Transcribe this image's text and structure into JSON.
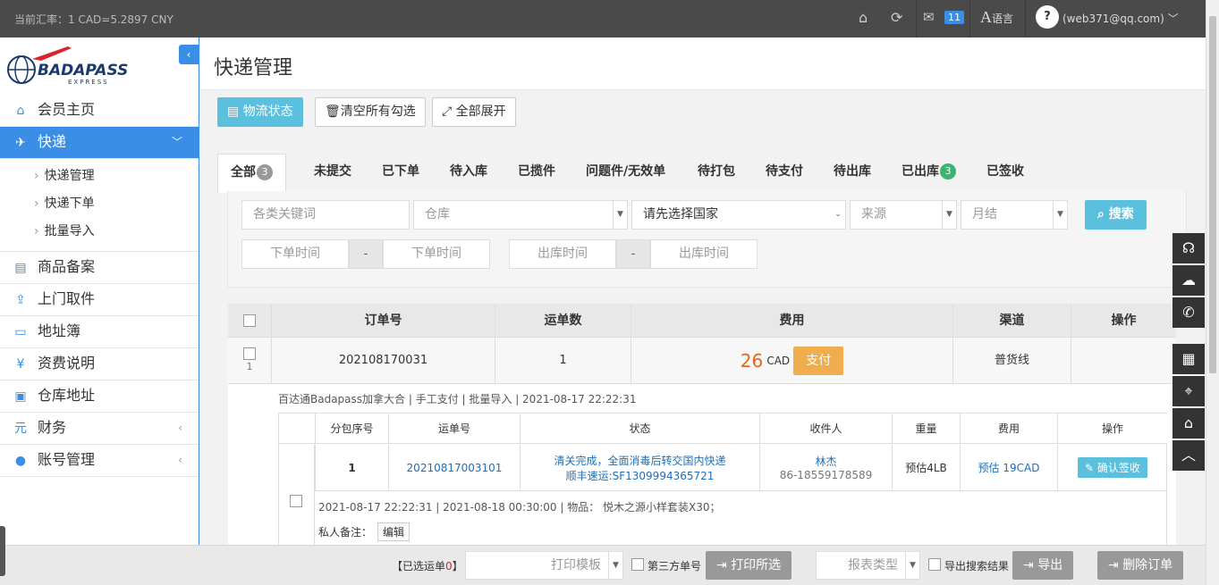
{
  "topbar": {
    "rate": "当前汇率：1 CAD=5.2897 CNY",
    "mail_count": "11",
    "lang_label": "语言",
    "user": "(web371@qq.com)"
  },
  "sidebar": {
    "brand": "BADAPASS",
    "brand_sub": "EXPRESS",
    "items": [
      {
        "label": "会员主页"
      },
      {
        "label": "快递"
      },
      {
        "label": "商品备案"
      },
      {
        "label": "上门取件"
      },
      {
        "label": "地址簿"
      },
      {
        "label": "资费说明"
      },
      {
        "label": "仓库地址"
      },
      {
        "label": "财务"
      },
      {
        "label": "账号管理"
      }
    ],
    "sub_items": [
      "快递管理",
      "快递下单",
      "批量导入"
    ]
  },
  "main": {
    "title": "快递管理",
    "toolbar": {
      "status_label": "物流状态",
      "clear_label": "清空所有勾选",
      "expand_label": "全部展开"
    },
    "tabs": [
      {
        "label": "全部",
        "badge": "3"
      },
      {
        "label": "未提交"
      },
      {
        "label": "已下单"
      },
      {
        "label": "待入库"
      },
      {
        "label": "已揽件"
      },
      {
        "label": "问题件/无效单"
      },
      {
        "label": "待打包"
      },
      {
        "label": "待支付"
      },
      {
        "label": "待出库"
      },
      {
        "label": "已出库",
        "badge": "3"
      },
      {
        "label": "已签收"
      }
    ],
    "filters": {
      "keyword_placeholder": "各类关键词",
      "warehouse_placeholder": "仓库",
      "country_placeholder": "请先选择国家",
      "source_placeholder": "来源",
      "monthly_placeholder": "月结",
      "search_label": "搜索",
      "order_time_start": "下单时间",
      "order_time_end": "下单时间",
      "out_time_start": "出库时间",
      "out_time_end": "出库时间",
      "dash": "-"
    },
    "table": {
      "headers": [
        "订单号",
        "运单数",
        "费用",
        "渠道",
        "操作"
      ],
      "row": {
        "index": "1",
        "order_no": "202108170031",
        "waybill_count": "1",
        "fee_amount": "26",
        "fee_currency": "CAD",
        "pay_label": "支付",
        "channel": "普货线"
      },
      "detail": {
        "info": "百达通Badapass加拿大合 | 手工支付 | 批量导入 | 2021-08-17 22:22:31",
        "sub_headers": [
          "分包序号",
          "运单号",
          "状态",
          "收件人",
          "重量",
          "费用",
          "操作"
        ],
        "sub_row": {
          "seq": "1",
          "waybill": "20210817003101",
          "status_line1": "清关完成，全面消毒后转交国内快递",
          "status_line2": "顺丰速运:SF1309994365721",
          "recipient_name": "林杰",
          "recipient_phone": "86-18559178589",
          "weight": "预估4LB",
          "fee": "预估 19CAD",
          "confirm_label": "确认签收"
        },
        "dates": "2021-08-17 22:22:31  |  2021-08-18 00:30:00  |  物品：  悦木之源小样套装X30；",
        "note_label": "私人备注：",
        "edit_label": "编辑"
      }
    }
  },
  "bottombar": {
    "selected_label": "【已选运单",
    "selected_count": "0",
    "selected_close": "】",
    "print_template": "打印模板",
    "third_party": "第三方单号",
    "print_selected": "打印所选",
    "report_type": "报表类型",
    "export_search": "导出搜索结果",
    "export_label": "导出",
    "delete_label": "删除订单"
  },
  "colors": {
    "accent": "#3a8ee6",
    "info": "#5bc0de",
    "warning": "#f0ad4e",
    "fee": "#e8641b"
  }
}
